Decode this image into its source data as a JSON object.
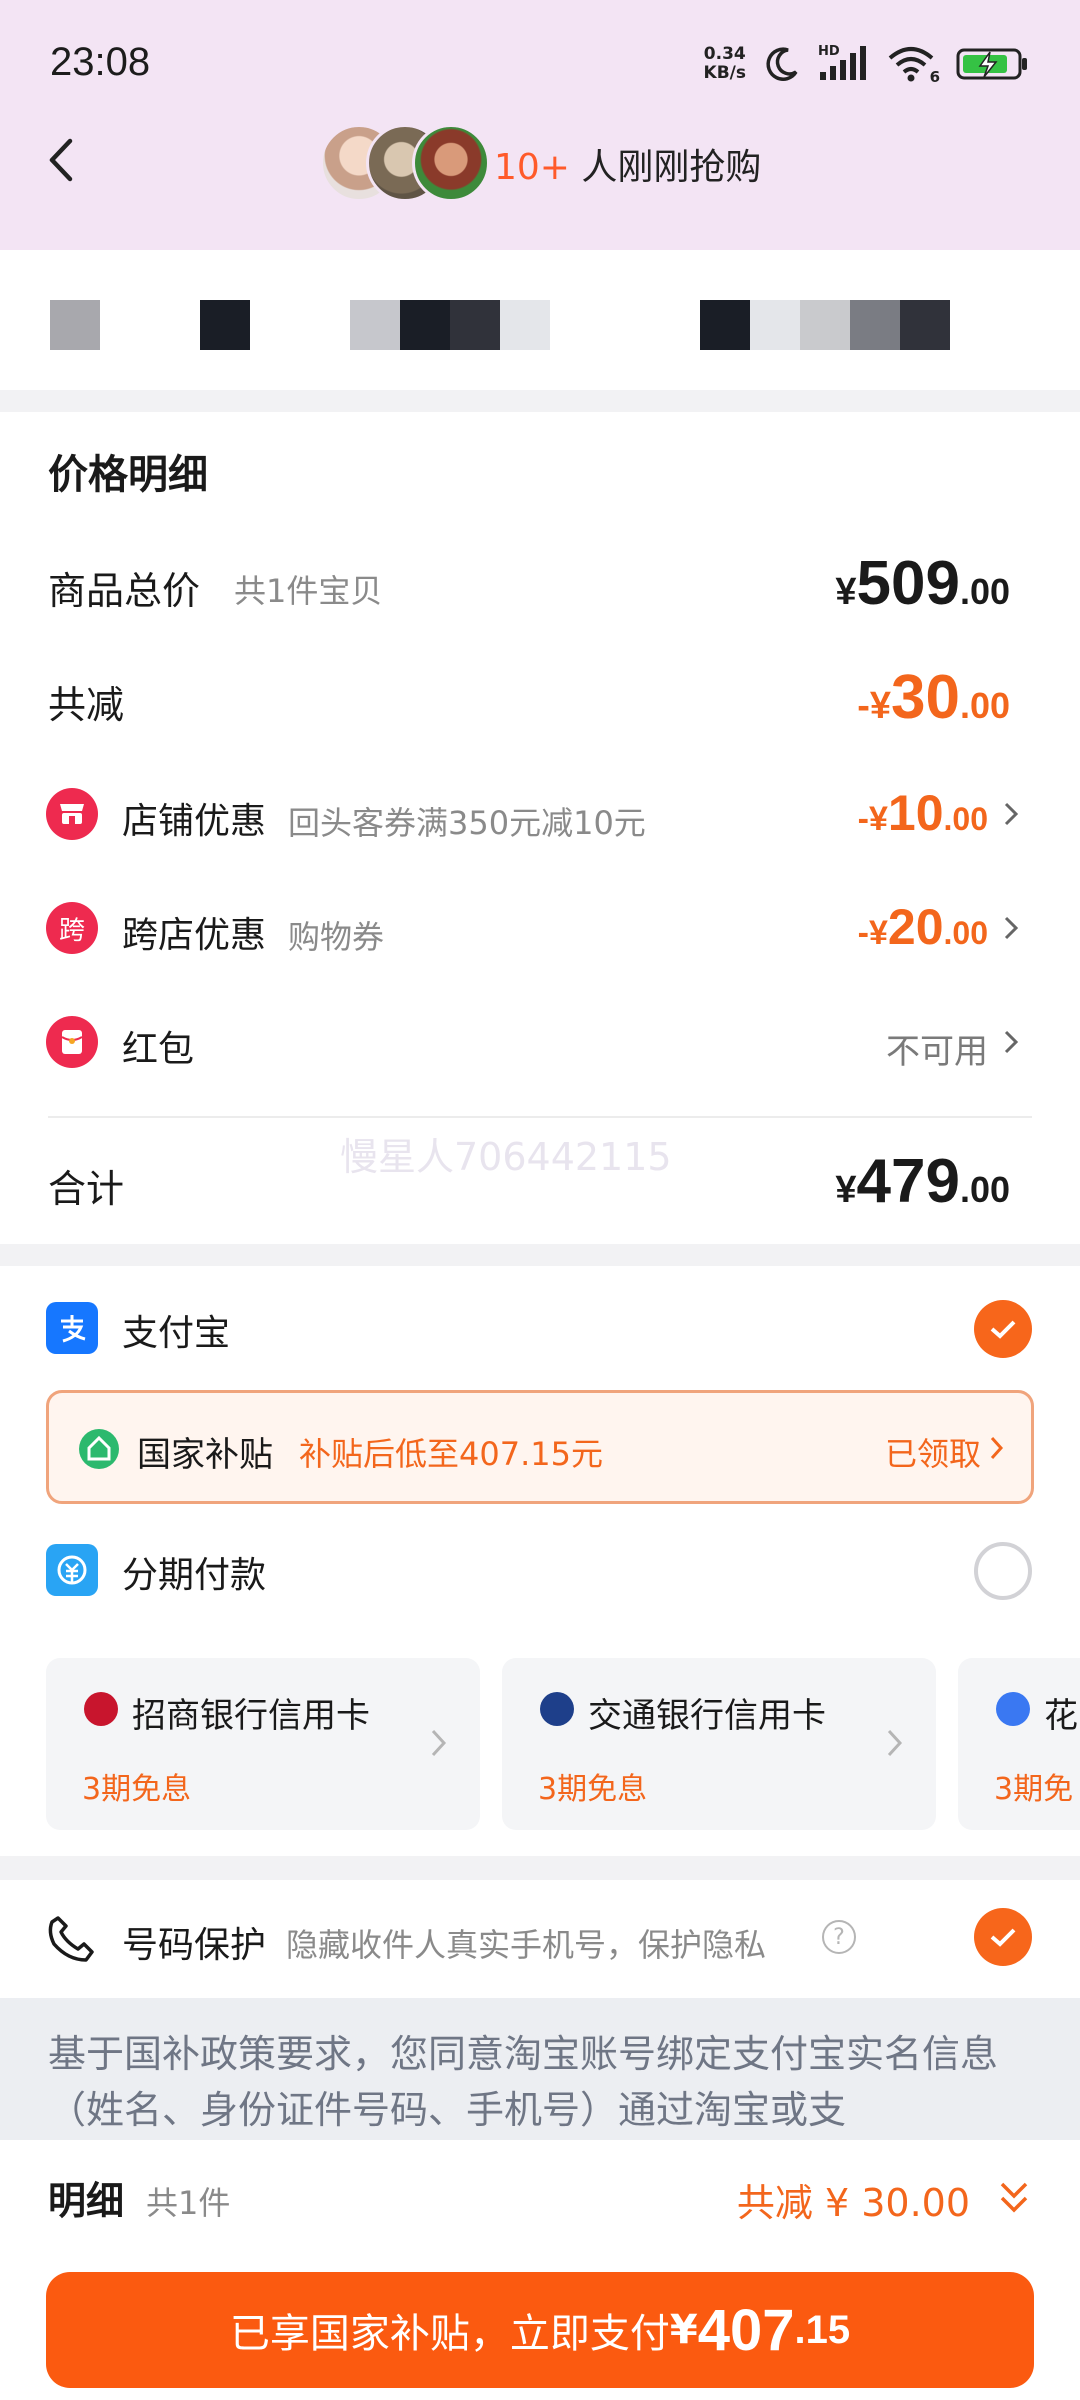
{
  "status_bar": {
    "time": "23:08",
    "net_speed_value": "0.34",
    "net_speed_unit": "KB/s",
    "signal_tag": "HD",
    "wifi_tag": "6"
  },
  "header": {
    "buyer_count": "10+",
    "buyer_text": " 人刚刚抢购"
  },
  "price_detail": {
    "title": "价格明细",
    "goods_total_label": "商品总价",
    "goods_total_sub": "共1件宝贝",
    "goods_total": {
      "currency": "¥",
      "int": "509",
      "dec": ".00"
    },
    "discount_label": "共减",
    "discount_total": {
      "currency": "-¥",
      "int": "30",
      "dec": ".00"
    },
    "shop_coupon": {
      "icon": "store-coupon-icon",
      "label": "店铺优惠",
      "desc": "回头客券满350元减10元",
      "amount": {
        "currency": "-¥",
        "int": "10",
        "dec": ".00"
      }
    },
    "cross_shop": {
      "icon_text": "跨",
      "label": "跨店优惠",
      "desc": "购物券",
      "amount": {
        "currency": "-¥",
        "int": "20",
        "dec": ".00"
      }
    },
    "red_packet": {
      "icon": "red-packet-icon",
      "label": "红包",
      "status": "不可用"
    },
    "sum_label": "合计",
    "sum": {
      "currency": "¥",
      "int": "479",
      "dec": ".00"
    },
    "watermark": "慢星人706442115"
  },
  "payment": {
    "alipay_label": "支付宝",
    "subsidy": {
      "title": "国家补贴",
      "desc": "补贴后低至407.15元",
      "status": "已领取"
    },
    "installment_label": "分期付款",
    "cards": [
      {
        "name": "招商银行信用卡",
        "term": "3期免息"
      },
      {
        "name": "交通银行信用卡",
        "term": "3期免息"
      },
      {
        "name": "花",
        "term": "3期免"
      }
    ]
  },
  "number_protect": {
    "label": "号码保护",
    "desc": "隐藏收件人真实手机号，保护隐私",
    "help": "?"
  },
  "notice": {
    "text": "基于国补政策要求，您同意淘宝账号绑定支付宝实名信息（姓名、身份证件号码、手机号）通过淘宝或支"
  },
  "bottom": {
    "detail_label": "明细",
    "detail_count": "共1件",
    "total_discount": "共减 ¥ 30.00",
    "pay_button_text": "已享国家补贴，立即支付",
    "pay_amount": {
      "currency": "¥",
      "int": "407",
      "dec": ".15"
    }
  },
  "colors": {
    "accent": "#f3661c",
    "pay_button": "#fb5a10",
    "header_bg": "#f3e4f4",
    "alipay_blue": "#1677ff",
    "coupon_red": "#ee2a4f"
  }
}
